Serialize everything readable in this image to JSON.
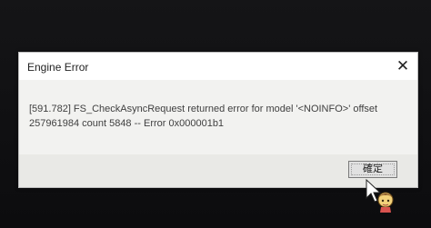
{
  "dialog": {
    "title": "Engine Error",
    "close_glyph": "✕",
    "message_line1": "[591.782] FS_CheckAsyncRequest returned error for model '<NOINFO>' offset",
    "message_line2": "257961984 count 5848 -- Error 0x000001b1",
    "ok_label": "確定"
  },
  "icons": {
    "close": "close-icon",
    "cursor": "mascot-cursor-icon"
  },
  "colors": {
    "dialog_bg": "#f2f2f0",
    "titlebar_bg": "#ffffff",
    "screen_bg": "#0e0e10"
  }
}
